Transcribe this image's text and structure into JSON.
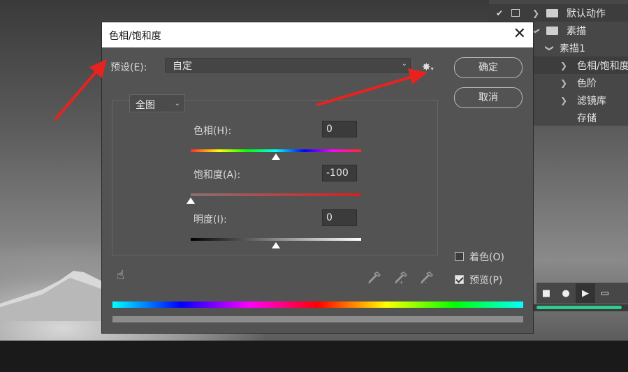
{
  "dialog": {
    "title": "色相/饱和度",
    "close_glyph": "✕",
    "preset_label": "预设(E):",
    "preset_value": "自定",
    "ok_label": "确定",
    "cancel_label": "取消",
    "channel_value": "全图",
    "hue_label": "色相(H):",
    "hue_value": "0",
    "saturation_label": "饱和度(A):",
    "saturation_value": "-100",
    "lightness_label": "明度(I):",
    "lightness_value": "0",
    "colorize_label": "着色(O)",
    "colorize_checked": false,
    "preview_label": "预览(P)",
    "preview_checked": true,
    "hue_range": [
      -180,
      180
    ],
    "saturation_range": [
      -100,
      100
    ],
    "lightness_range": [
      -100,
      100
    ]
  },
  "actions_panel": {
    "rows": [
      {
        "label": "默认动作",
        "checked": true
      },
      {
        "label": "素描"
      },
      {
        "label": "素描1"
      },
      {
        "label": "色相/饱和度"
      },
      {
        "label": "色阶"
      },
      {
        "label": "滤镜库"
      },
      {
        "label": "存储"
      }
    ],
    "controls": [
      "stop-icon",
      "record-icon",
      "play-icon",
      "folder-icon"
    ]
  },
  "colors": {
    "annotation_arrow": "#e8231f",
    "dialog_bg": "#535353",
    "accent_scroll": "#2ecc8f"
  }
}
